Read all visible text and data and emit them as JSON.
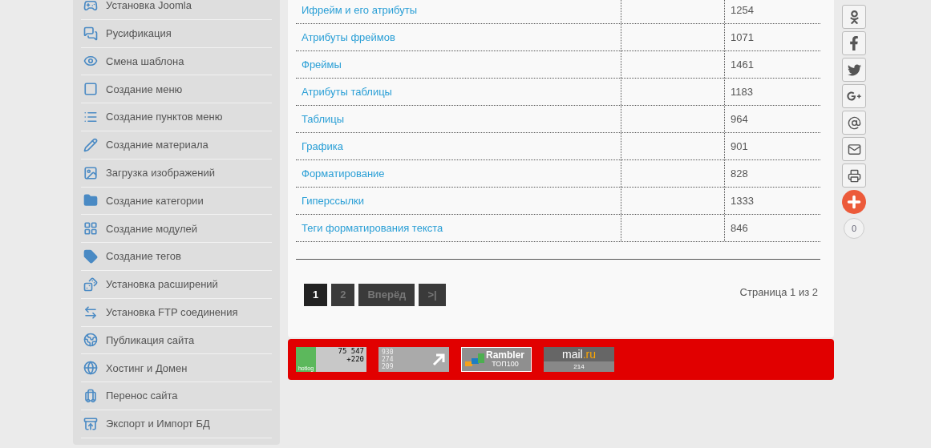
{
  "sidebar": {
    "items": [
      {
        "label": "Установка Joomla"
      },
      {
        "label": "Русификация"
      },
      {
        "label": "Смена шаблона"
      },
      {
        "label": "Создание меню"
      },
      {
        "label": "Создание пунктов меню"
      },
      {
        "label": "Создание материала"
      },
      {
        "label": "Загрузка изображений"
      },
      {
        "label": "Создание категории"
      },
      {
        "label": "Создание модулей"
      },
      {
        "label": "Создание тегов"
      },
      {
        "label": "Установка расширений"
      },
      {
        "label": "Установка FTP соединения"
      },
      {
        "label": "Публикация сайта"
      },
      {
        "label": "Хостинг и Домен"
      },
      {
        "label": "Перенос сайта"
      },
      {
        "label": "Экспорт и Импорт БД"
      }
    ]
  },
  "table": {
    "rows": [
      {
        "title": "Ифрейм и его атрибуты",
        "hits": "1254"
      },
      {
        "title": "Атрибуты фреймов",
        "hits": "1071"
      },
      {
        "title": "Фреймы",
        "hits": "1461"
      },
      {
        "title": "Атрибуты таблицы",
        "hits": "1183"
      },
      {
        "title": "Таблицы",
        "hits": "964"
      },
      {
        "title": "Графика",
        "hits": "901"
      },
      {
        "title": "Форматирование",
        "hits": "828"
      },
      {
        "title": "Гиперссылки",
        "hits": "1333"
      },
      {
        "title": "Теги форматирования текста",
        "hits": "846"
      }
    ]
  },
  "pagination": {
    "items": [
      {
        "label": "1",
        "selected": true
      },
      {
        "label": "2",
        "selected": false
      },
      {
        "label": "Вперёд",
        "selected": false
      },
      {
        "label": ">|",
        "selected": false
      }
    ],
    "summary": "Страница 1 из 2"
  },
  "counters": {
    "hotlog": {
      "brand": "hotlog",
      "total": "75 547",
      "today": "+220"
    },
    "liveinternet": {
      "lines": [
        "930",
        "274",
        "209"
      ]
    },
    "rambler": {
      "brand": "Rambler",
      "sub": "ТОП100"
    },
    "mail": {
      "brand": "mail",
      "suffix": ".ru",
      "count": "214"
    }
  },
  "share": {
    "count": "0"
  }
}
